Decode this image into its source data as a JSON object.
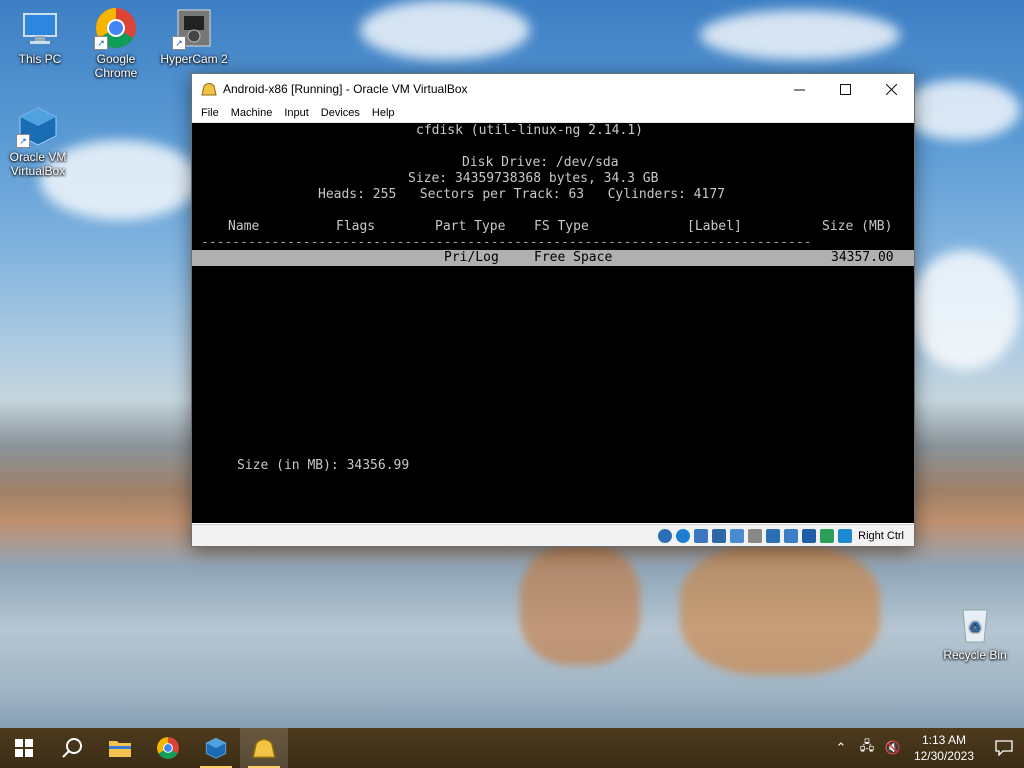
{
  "desktop": {
    "icons": [
      {
        "label": "This PC"
      },
      {
        "label": "Google Chrome"
      },
      {
        "label": "HyperCam 2"
      },
      {
        "label": "Oracle VM VirtualBox"
      },
      {
        "label": "Recycle Bin"
      }
    ]
  },
  "window": {
    "title": "Android-x86 [Running] - Oracle VM VirtualBox",
    "menu": [
      "File",
      "Machine",
      "Input",
      "Devices",
      "Help"
    ],
    "console_lines": {
      "program": "cfdisk (util-linux-ng 2.14.1)",
      "disk": "Disk Drive: /dev/sda",
      "size": "Size: 34359738368 bytes, 34.3 GB",
      "geometry": "Heads: 255   Sectors per Track: 63   Cylinders: 4177",
      "col_name": "Name",
      "col_flags": "Flags",
      "col_part_type": "Part Type",
      "col_fs_type": "FS Type",
      "col_label": "[Label]",
      "col_size": "Size (MB)",
      "separator": "------------------------------------------------------------------------------",
      "row_part_type": "Pri/Log",
      "row_fs_type": "Free Space",
      "row_size": "34357.00",
      "prompt": "Size (in MB): 34356.99"
    },
    "host_key": "Right Ctrl"
  },
  "taskbar": {
    "time": "1:13 AM",
    "date": "12/30/2023"
  }
}
